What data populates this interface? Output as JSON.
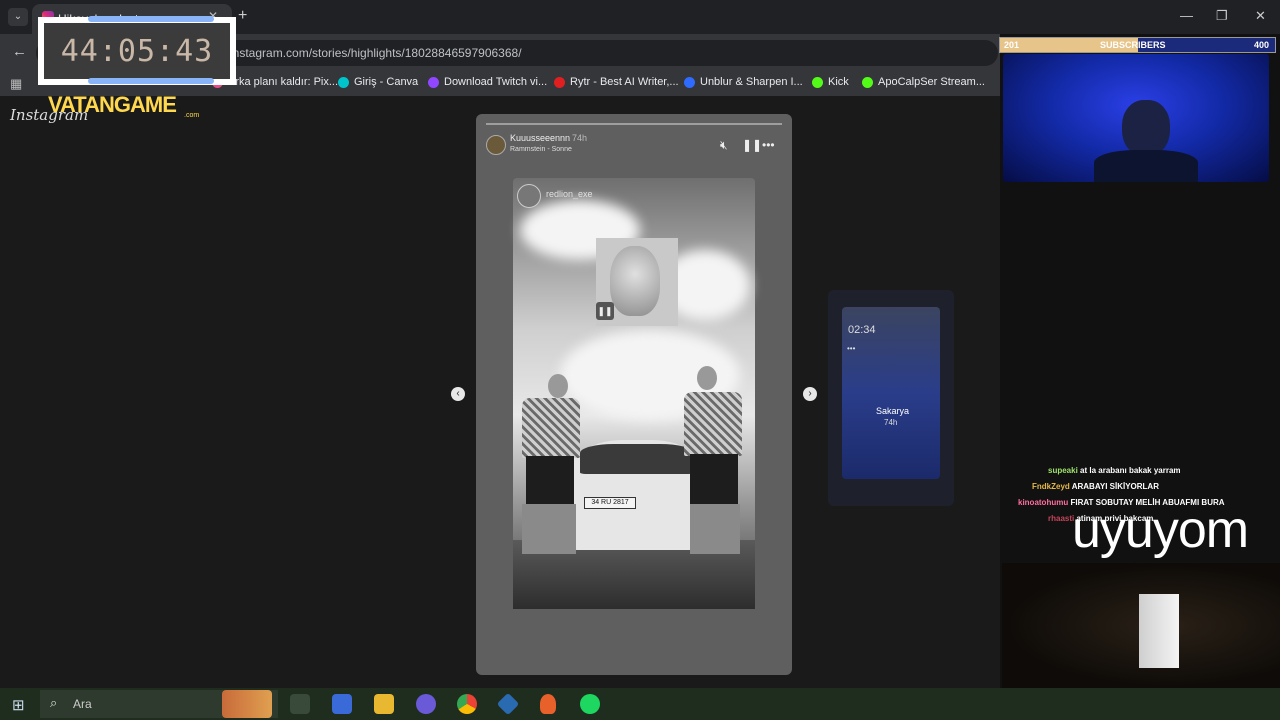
{
  "browser": {
    "tab_title": "Hikayeler • Instagram",
    "url": "instagram.com/stories/highlights/18028846597906368/",
    "bookmarks": [
      "Arka planı kaldır: Pix...",
      "Giriş - Canva",
      "Download Twitch vi...",
      "Rytr - Best AI Writer,...",
      "Unblur & Sharpen I...",
      "Kick",
      "ApoCalpSer Stream..."
    ],
    "bookmark_colors": [
      "#ea4c89",
      "#00c4cc",
      "#9146ff",
      "#e02020",
      "#2f6bff",
      "#53fc18",
      "#53fc18"
    ]
  },
  "instagram": {
    "logo": "Instagram",
    "story": {
      "username": "Kuuusseeennn",
      "time": "74h",
      "song": "Rammstein - Sonne",
      "inner_username": "redlion_exe",
      "plate": "34 RU 2817"
    },
    "next_story": {
      "time": "02:34",
      "place": "Sakarya",
      "ago": "74h"
    }
  },
  "overlay": {
    "timer": "44:05:43",
    "brand": "VATANGAME",
    "brand_suffix": ".com",
    "subscribers": {
      "current": "201",
      "label": "SUBSCRIBERS",
      "goal": "400",
      "progress": 0.5
    },
    "big_text": "uyuyom",
    "chat": [
      {
        "user": "supeaki",
        "msg": "at la arabanı bakak yarram",
        "color": "#9fe36b"
      },
      {
        "user": "FndkZeyd",
        "msg": "ARABAYI SİKİYORLAR",
        "color": "#e6b84a"
      },
      {
        "user": "kinoatohumu",
        "msg": "FIRAT SOBUTAY MELİH ABUAFMI BURA",
        "color": "#ff6fa0"
      },
      {
        "user": "rhaasti",
        "msg": "atinam privi bakcam",
        "color": "#c4455a"
      }
    ]
  },
  "taskbar": {
    "search_placeholder": "Ara"
  }
}
